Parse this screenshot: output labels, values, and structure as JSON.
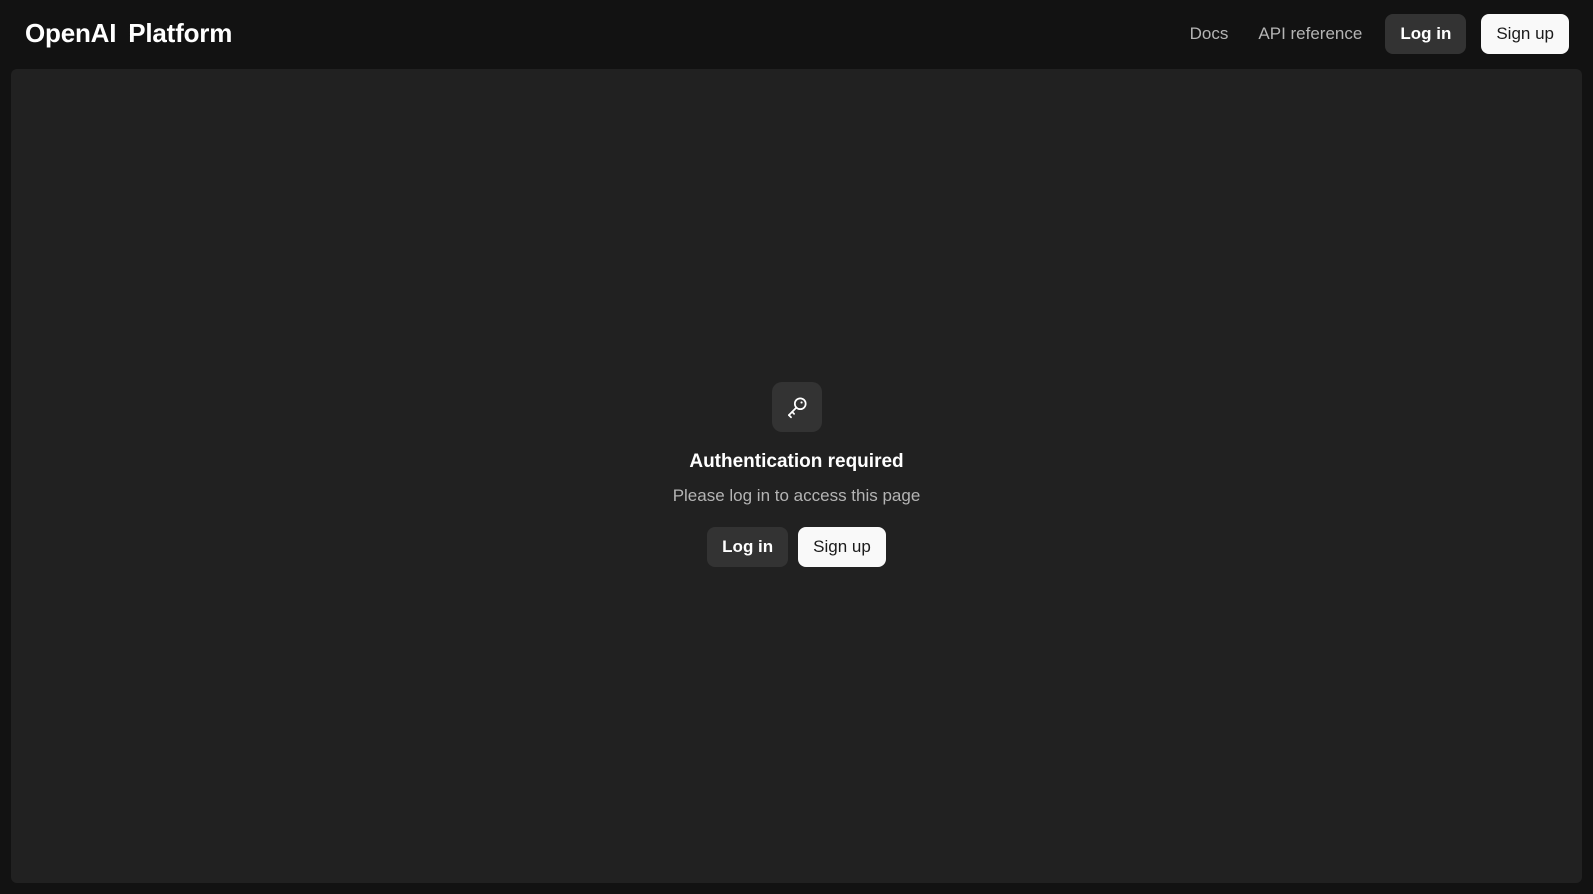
{
  "header": {
    "brand_logo": "OpenAI",
    "brand_product": "Platform",
    "nav": {
      "docs": "Docs",
      "api_reference": "API reference"
    },
    "login_label": "Log in",
    "signup_label": "Sign up"
  },
  "auth": {
    "icon": "key-icon",
    "title": "Authentication required",
    "subtitle": "Please log in to access this page",
    "login_label": "Log in",
    "signup_label": "Sign up"
  },
  "colors": {
    "page_background": "#121212",
    "panel_background": "#212121",
    "dark_button": "#333333",
    "light_button": "#f9f9f9",
    "muted_text": "#b4b4b4"
  }
}
